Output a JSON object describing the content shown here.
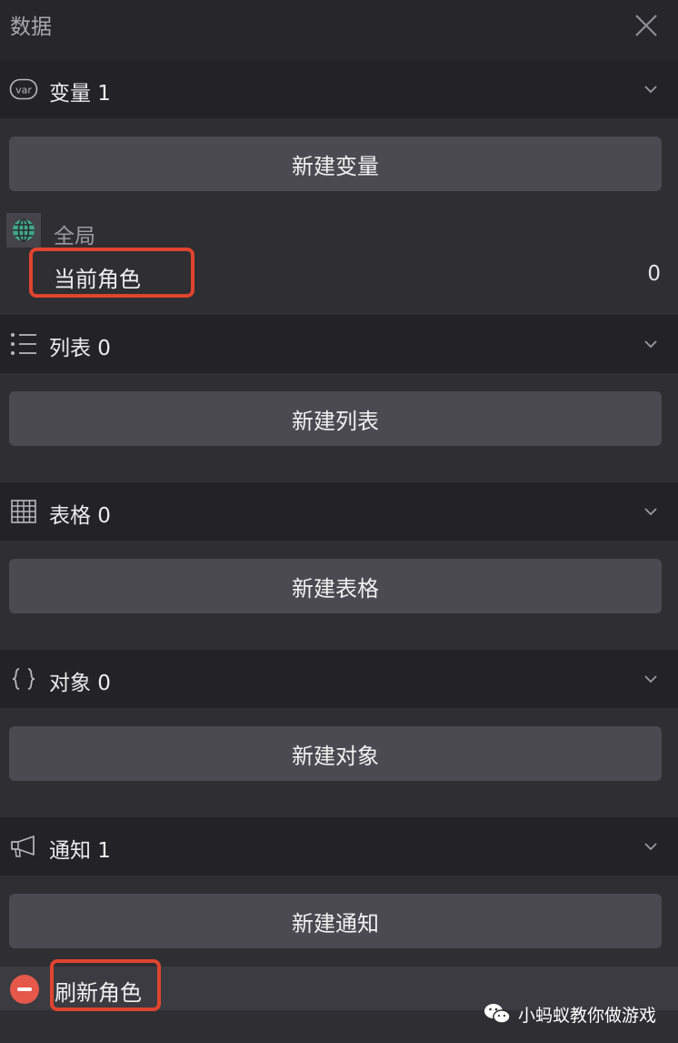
{
  "window": {
    "title": "数据"
  },
  "sections": {
    "variables": {
      "label": "变量 1",
      "new_button": "新建变量"
    },
    "lists": {
      "label": "列表 0",
      "new_button": "新建列表"
    },
    "tables": {
      "label": "表格 0",
      "new_button": "新建表格"
    },
    "objects": {
      "label": "对象 0",
      "new_button": "新建对象"
    },
    "notifications": {
      "label": "通知 1",
      "new_button": "新建通知"
    }
  },
  "variable_group": {
    "scope_label": "全局",
    "items": [
      {
        "name": "当前角色",
        "value": "0"
      }
    ]
  },
  "notification_items": [
    {
      "name": "刷新角色"
    }
  ],
  "watermark": {
    "text": "小蚂蚁教你做游戏"
  },
  "colors": {
    "background": "#2e2e33",
    "header": "#232327",
    "button": "#4a4a50",
    "highlight": "#e0442e",
    "delete": "#e5584a",
    "globe": "#3fa98a"
  },
  "icons": {
    "close": "close-icon",
    "variables": "var-icon",
    "lists": "list-icon",
    "tables": "table-grid-icon",
    "objects": "braces-icon",
    "notifications": "megaphone-icon",
    "scope": "globe-icon",
    "collapse": "chevron-down-icon"
  }
}
